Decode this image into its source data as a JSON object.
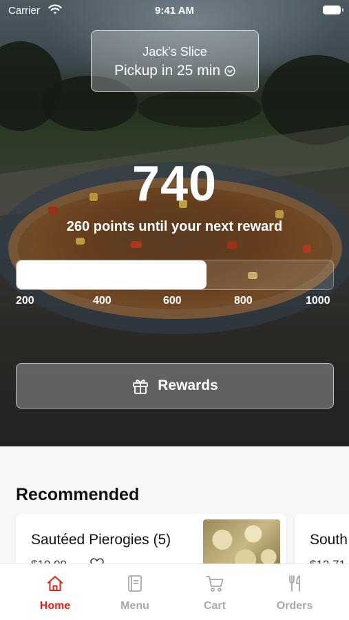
{
  "status_bar": {
    "carrier": "Carrier",
    "time": "9:41 AM"
  },
  "store": {
    "name": "Jack's Slice",
    "pickup": "Pickup in 25 min"
  },
  "rewards": {
    "points": "740",
    "subtitle": "260 points until your next reward",
    "progress_fraction": 0.6,
    "ticks": [
      "200",
      "400",
      "600",
      "800",
      "1000"
    ],
    "button_label": "Rewards"
  },
  "recommended": {
    "title": "Recommended",
    "items": [
      {
        "name": "Sautéed Pierogies (5)",
        "price": "$10.99"
      },
      {
        "name": "South",
        "price": "$12.71"
      }
    ]
  },
  "tabs": [
    {
      "label": "Home",
      "active": true
    },
    {
      "label": "Menu",
      "active": false
    },
    {
      "label": "Cart",
      "active": false
    },
    {
      "label": "Orders",
      "active": false
    }
  ],
  "colors": {
    "accent": "#e0201c",
    "tab_inactive": "#a8a8a8"
  }
}
